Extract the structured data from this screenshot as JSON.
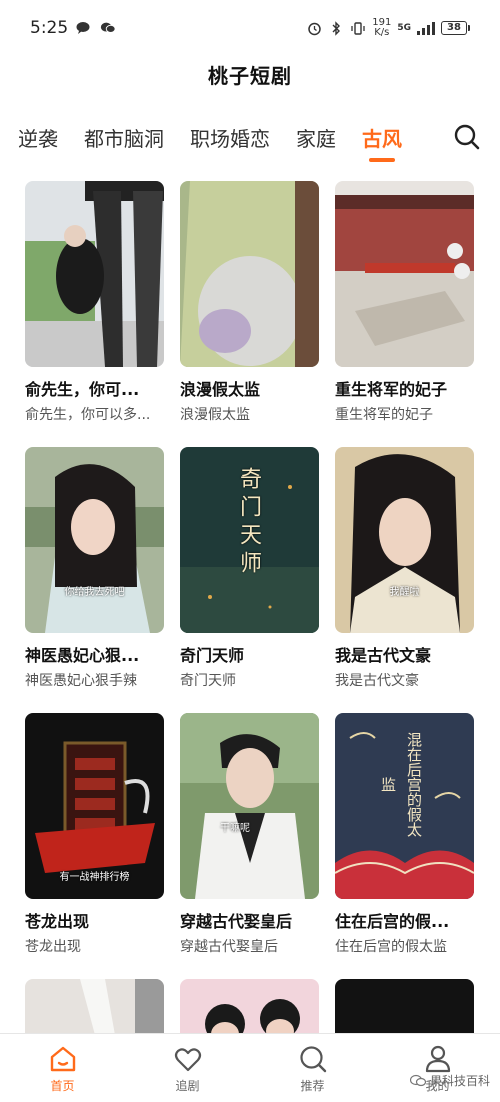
{
  "status_bar": {
    "time": "5:25",
    "net_speed_value": "191",
    "net_speed_unit": "K/s",
    "network": "5G",
    "battery": "38"
  },
  "app_title": "桃子短剧",
  "tabs": [
    {
      "label": "逆袭",
      "active": false
    },
    {
      "label": "都市脑洞",
      "active": false
    },
    {
      "label": "职场婚恋",
      "active": false
    },
    {
      "label": "家庭",
      "active": false
    },
    {
      "label": "古风",
      "active": true
    }
  ],
  "cards": [
    {
      "title": "俞先生，你可...",
      "subtitle": "俞先生，你可以多...",
      "caption": ""
    },
    {
      "title": "浪漫假太监",
      "subtitle": "浪漫假太监",
      "caption": ""
    },
    {
      "title": "重生将军的妃子",
      "subtitle": "重生将军的妃子",
      "caption": ""
    },
    {
      "title": "神医愚妃心狠...",
      "subtitle": "神医愚妃心狠手辣",
      "caption": "你给我去死吧"
    },
    {
      "title": "奇门天师",
      "subtitle": "奇门天师",
      "caption": "奇门天师"
    },
    {
      "title": "我是古代文豪",
      "subtitle": "我是古代文豪",
      "caption": "我醒啦"
    },
    {
      "title": "苍龙出现",
      "subtitle": "苍龙出现",
      "caption": "有一战神排行榜"
    },
    {
      "title": "穿越古代娶皇后",
      "subtitle": "穿越古代娶皇后",
      "caption": "干嘛呢"
    },
    {
      "title": "住在后宫的假...",
      "subtitle": "住在后宫的假太监",
      "caption": "混在后宫的假太监"
    }
  ],
  "bottom_nav": [
    {
      "label": "首页",
      "icon": "home-icon",
      "active": true
    },
    {
      "label": "追剧",
      "icon": "heart-icon",
      "active": false
    },
    {
      "label": "推荐",
      "icon": "search-icon",
      "active": false
    },
    {
      "label": "我的",
      "icon": "user-icon",
      "active": false
    }
  ],
  "watermark": "果科技百科",
  "colors": {
    "accent": "#ff6a1a"
  }
}
